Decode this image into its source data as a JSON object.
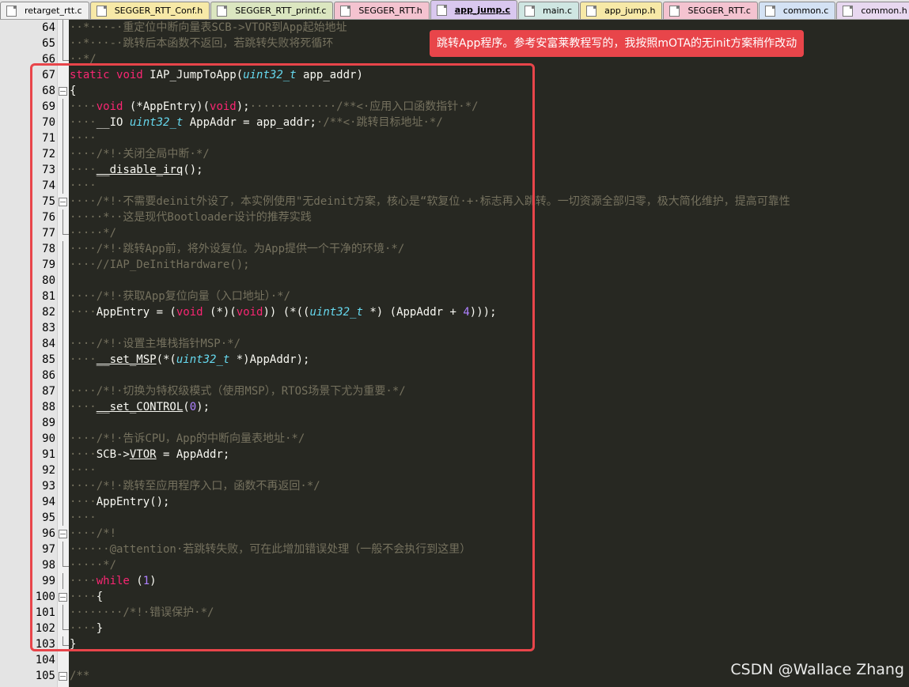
{
  "tabs": [
    {
      "label": "retarget_rtt.c",
      "color": "#f0f0f0"
    },
    {
      "label": "SEGGER_RTT_Conf.h",
      "color": "#f7e9a7"
    },
    {
      "label": "SEGGER_RTT_printf.c",
      "color": "#dbe6c0"
    },
    {
      "label": "SEGGER_RTT.h",
      "color": "#f4c3d0"
    },
    {
      "label": "app_jump.c",
      "color": "#d9c8ef",
      "active": true
    },
    {
      "label": "main.c",
      "color": "#cfe6e2"
    },
    {
      "label": "app_jump.h",
      "color": "#f7e9a7"
    },
    {
      "label": "SEGGER_RTT.c",
      "color": "#f4c3d0"
    },
    {
      "label": "common.c",
      "color": "#d4e2f4"
    },
    {
      "label": "common.h",
      "color": "#e8d8f0"
    }
  ],
  "annotation": "跳转App程序。参考安富莱教程写的，我按照mOTA的无init方案稍作改动",
  "watermark": "CSDN @Wallace Zhang",
  "code": [
    {
      "n": "64",
      "fold": "line",
      "segs": [
        [
          "cmt",
          "··*···-·重定位中断向量表SCB->VTOR到App起始地址"
        ]
      ]
    },
    {
      "n": "65",
      "fold": "line",
      "segs": [
        [
          "cmt",
          "··*···-·跳转后本函数不返回，若跳转失败将死循环"
        ]
      ]
    },
    {
      "n": "66",
      "fold": "end",
      "segs": [
        [
          "cmt",
          "··*/"
        ]
      ]
    },
    {
      "n": "67",
      "fold": "",
      "segs": [
        [
          "kw",
          "static"
        ],
        [
          "",
          " "
        ],
        [
          "kw",
          "void"
        ],
        [
          "",
          " IAP_JumpToApp("
        ],
        [
          "tp",
          "uint32_t"
        ],
        [
          "",
          " app_addr)"
        ]
      ]
    },
    {
      "n": "68",
      "fold": "box",
      "segs": [
        [
          "",
          "{"
        ]
      ]
    },
    {
      "n": "69",
      "fold": "line",
      "segs": [
        [
          "cmt",
          "····"
        ],
        [
          "kw",
          "void"
        ],
        [
          "",
          " (*AppEntry)("
        ],
        [
          "kw",
          "void"
        ],
        [
          "",
          ");"
        ],
        [
          "cmt",
          "·············/**<·应用入口函数指针·*/"
        ]
      ]
    },
    {
      "n": "70",
      "fold": "line",
      "segs": [
        [
          "cmt",
          "····"
        ],
        [
          "",
          "__IO "
        ],
        [
          "tp",
          "uint32_t"
        ],
        [
          "",
          " AppAddr = app_addr;"
        ],
        [
          "cmt",
          "·/**<·跳转目标地址·*/"
        ]
      ]
    },
    {
      "n": "71",
      "fold": "line",
      "segs": [
        [
          "cmt",
          "····"
        ]
      ]
    },
    {
      "n": "72",
      "fold": "line",
      "segs": [
        [
          "cmt",
          "····/*!·关闭全局中断·*/"
        ]
      ]
    },
    {
      "n": "73",
      "fold": "line",
      "segs": [
        [
          "cmt",
          "····"
        ],
        [
          "ul",
          "__disable_irq"
        ],
        [
          "",
          "();"
        ]
      ]
    },
    {
      "n": "74",
      "fold": "line",
      "segs": [
        [
          "cmt",
          "····"
        ]
      ]
    },
    {
      "n": "75",
      "fold": "box",
      "segs": [
        [
          "cmt",
          "····/*!·不需要deinit外设了，本实例使用\"无deinit方案，核心是“软复位·+·标志再入跳转。一切资源全部归零，极大简化维护，提高可靠性"
        ]
      ]
    },
    {
      "n": "76",
      "fold": "line",
      "segs": [
        [
          "cmt",
          "·····*··这是现代Bootloader设计的推荐实践"
        ]
      ]
    },
    {
      "n": "77",
      "fold": "end",
      "segs": [
        [
          "cmt",
          "·····*/"
        ]
      ]
    },
    {
      "n": "78",
      "fold": "line",
      "segs": [
        [
          "cmt",
          "····/*!·跳转App前，将外设复位。为App提供一个干净的环境·*/"
        ]
      ]
    },
    {
      "n": "79",
      "fold": "line",
      "segs": [
        [
          "cmt",
          "····//IAP_DeInitHardware();"
        ]
      ]
    },
    {
      "n": "80",
      "fold": "line",
      "segs": []
    },
    {
      "n": "81",
      "fold": "line",
      "segs": [
        [
          "cmt",
          "····/*!·获取App复位向量（入口地址）·*/"
        ]
      ]
    },
    {
      "n": "82",
      "fold": "line",
      "segs": [
        [
          "cmt",
          "····"
        ],
        [
          "",
          "AppEntry = ("
        ],
        [
          "kw",
          "void"
        ],
        [
          "",
          " (*)("
        ],
        [
          "kw",
          "void"
        ],
        [
          "",
          ")) (*(("
        ],
        [
          "tp",
          "uint32_t"
        ],
        [
          "",
          " *) (AppAddr + "
        ],
        [
          "num",
          "4"
        ],
        [
          "",
          ")));"
        ]
      ]
    },
    {
      "n": "83",
      "fold": "line",
      "segs": []
    },
    {
      "n": "84",
      "fold": "line",
      "segs": [
        [
          "cmt",
          "····/*!·设置主堆栈指针MSP·*/"
        ]
      ]
    },
    {
      "n": "85",
      "fold": "line",
      "segs": [
        [
          "cmt",
          "····"
        ],
        [
          "ul",
          "__set_MSP"
        ],
        [
          "",
          "(*("
        ],
        [
          "tp",
          "uint32_t"
        ],
        [
          "",
          " *)AppAddr);"
        ]
      ]
    },
    {
      "n": "86",
      "fold": "line",
      "segs": []
    },
    {
      "n": "87",
      "fold": "line",
      "segs": [
        [
          "cmt",
          "····/*!·切换为特权级模式（使用MSP），RTOS场景下尤为重要·*/"
        ]
      ]
    },
    {
      "n": "88",
      "fold": "line",
      "segs": [
        [
          "cmt",
          "····"
        ],
        [
          "ul",
          "__set_CONTROL"
        ],
        [
          "",
          "("
        ],
        [
          "num",
          "0"
        ],
        [
          "",
          ");"
        ]
      ]
    },
    {
      "n": "89",
      "fold": "line",
      "segs": []
    },
    {
      "n": "90",
      "fold": "line",
      "segs": [
        [
          "cmt",
          "····/*!·告诉CPU，App的中断向量表地址·*/"
        ]
      ]
    },
    {
      "n": "91",
      "fold": "line",
      "segs": [
        [
          "cmt",
          "····"
        ],
        [
          "",
          "SCB->"
        ],
        [
          "ul",
          "VTOR"
        ],
        [
          "",
          " = AppAddr;"
        ]
      ]
    },
    {
      "n": "92",
      "fold": "line",
      "segs": [
        [
          "cmt",
          "····"
        ]
      ]
    },
    {
      "n": "93",
      "fold": "line",
      "segs": [
        [
          "cmt",
          "····/*!·跳转至应用程序入口，函数不再返回·*/"
        ]
      ]
    },
    {
      "n": "94",
      "fold": "line",
      "segs": [
        [
          "cmt",
          "····"
        ],
        [
          "",
          "AppEntry();"
        ]
      ]
    },
    {
      "n": "95",
      "fold": "line",
      "segs": [
        [
          "cmt",
          "····"
        ]
      ]
    },
    {
      "n": "96",
      "fold": "box",
      "segs": [
        [
          "cmt",
          "····/*!"
        ]
      ]
    },
    {
      "n": "97",
      "fold": "line",
      "segs": [
        [
          "cmt",
          "······@attention·若跳转失败，可在此增加错误处理（一般不会执行到这里）"
        ]
      ]
    },
    {
      "n": "98",
      "fold": "end",
      "segs": [
        [
          "cmt",
          "·····*/"
        ]
      ]
    },
    {
      "n": "99",
      "fold": "line",
      "segs": [
        [
          "cmt",
          "····"
        ],
        [
          "kw",
          "while"
        ],
        [
          "",
          " ("
        ],
        [
          "num",
          "1"
        ],
        [
          "",
          ")"
        ]
      ]
    },
    {
      "n": "100",
      "fold": "box",
      "segs": [
        [
          "cmt",
          "····"
        ],
        [
          "",
          "{"
        ]
      ]
    },
    {
      "n": "101",
      "fold": "line",
      "segs": [
        [
          "cmt",
          "········/*!·错误保护·*/"
        ]
      ]
    },
    {
      "n": "102",
      "fold": "end",
      "segs": [
        [
          "cmt",
          "····"
        ],
        [
          "",
          "}"
        ]
      ]
    },
    {
      "n": "103",
      "fold": "end",
      "segs": [
        [
          "",
          "}"
        ]
      ]
    },
    {
      "n": "104",
      "fold": "",
      "segs": []
    },
    {
      "n": "105",
      "fold": "box",
      "segs": [
        [
          "cmt",
          "/**"
        ]
      ]
    }
  ]
}
